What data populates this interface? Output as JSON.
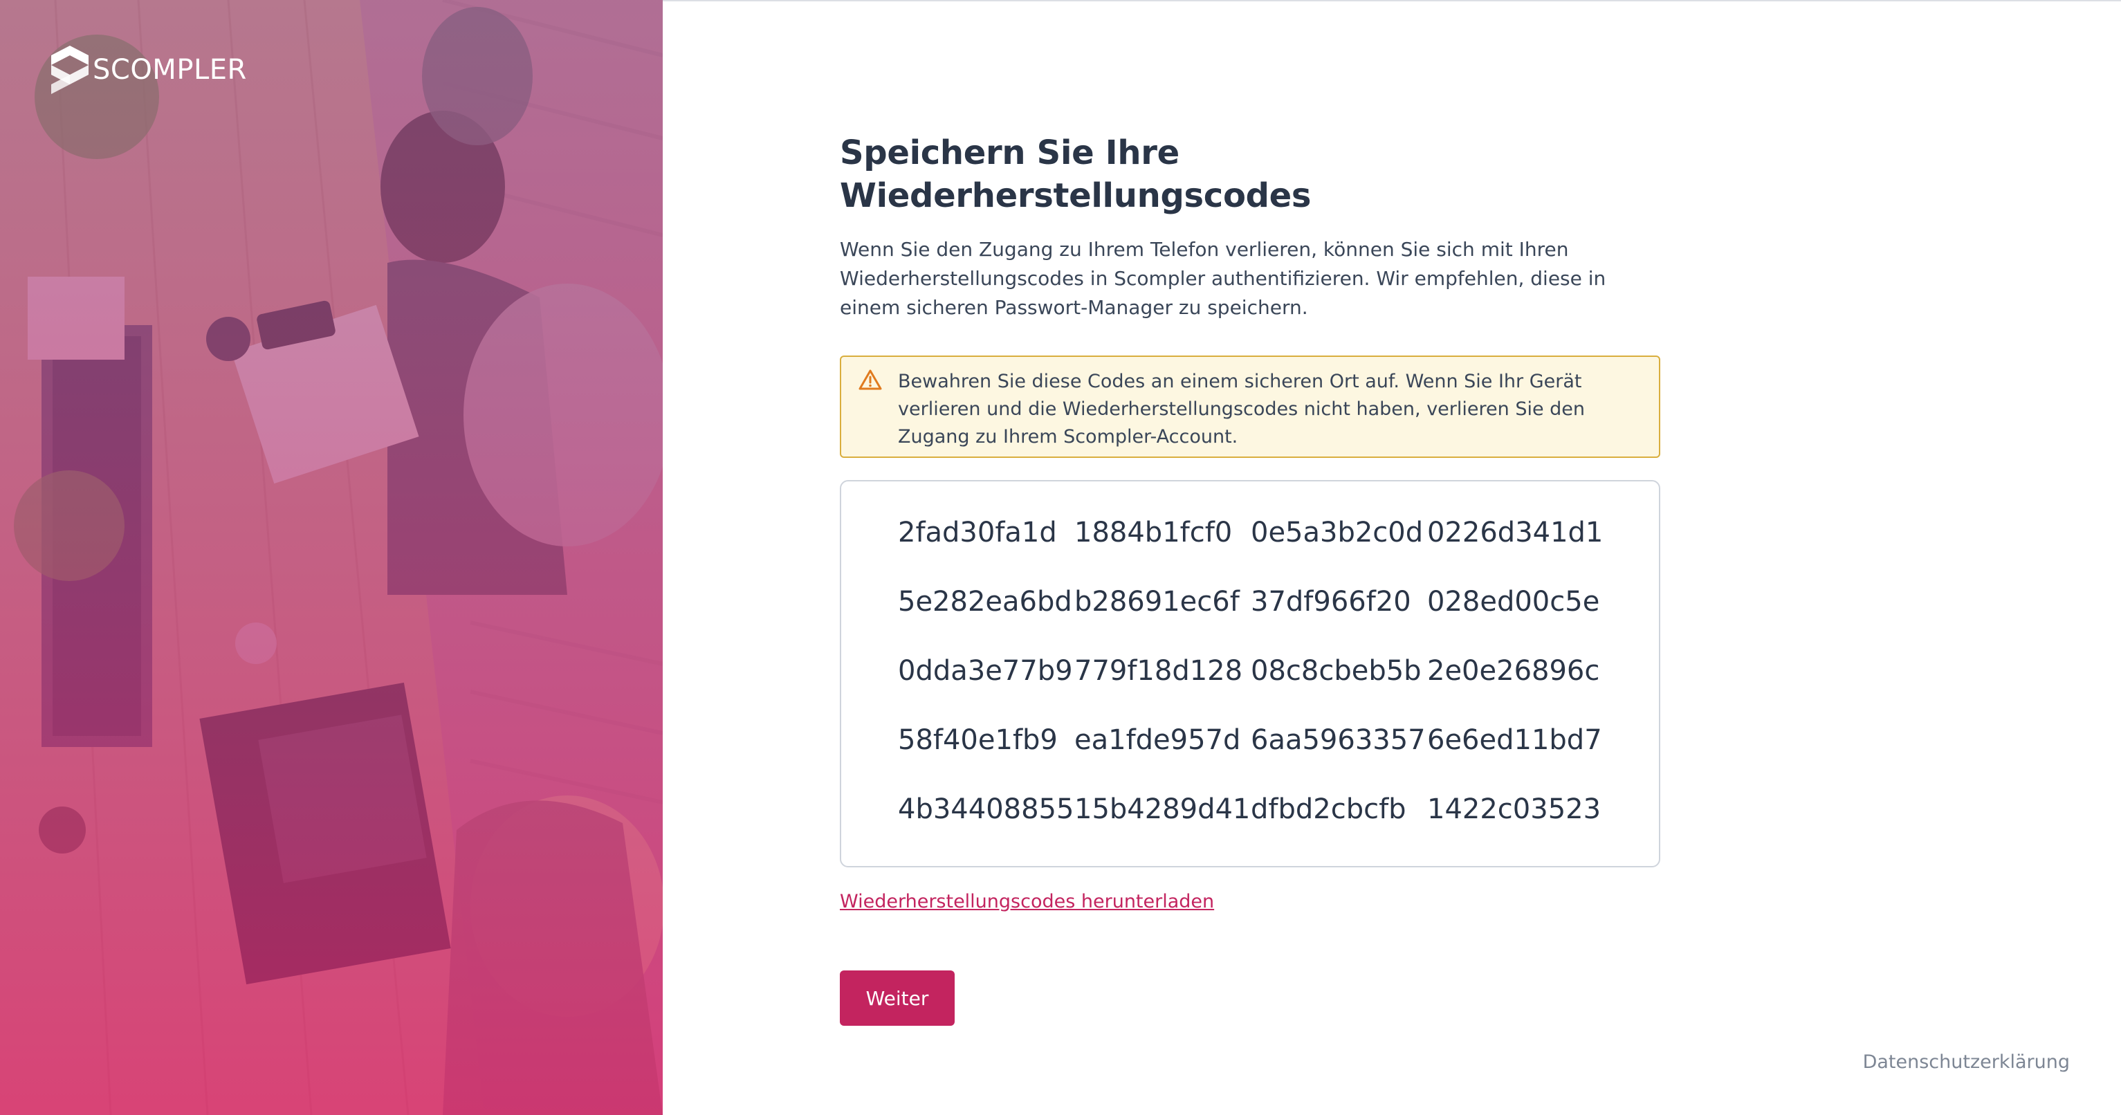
{
  "brand": {
    "name": "SCOMPLER"
  },
  "page": {
    "title": "Speichern Sie Ihre Wiederherstellungscodes",
    "intro": "Wenn Sie den Zugang zu Ihrem Telefon verlieren, können Sie sich mit Ihren Wiederherstellungscodes in Scompler authentifizieren. Wir empfehlen, diese in einem sicheren Passwort-Manager zu speichern."
  },
  "alert": {
    "icon": "warning-icon",
    "text": "Bewahren Sie diese Codes an einem sicheren Ort auf. Wenn Sie Ihr Gerät verlieren und die Wiederherstellungscodes nicht haben, verlieren Sie den Zugang zu Ihrem Scompler-Account."
  },
  "codes": [
    "2fad30fa1d",
    "1884b1fcf0",
    "0e5a3b2c0d",
    "0226d341d1",
    "5e282ea6bd",
    "b28691ec6f",
    "37df966f20",
    "028ed00c5e",
    "0dda3e77b9",
    "779f18d128",
    "08c8cbeb5b",
    "2e0e26896c",
    "58f40e1fb9",
    "ea1fde957d",
    "6aa5963357",
    "6e6ed11bd7",
    "4b34408855",
    "15b4289d41",
    "dfbd2cbcfb",
    "1422c03523"
  ],
  "actions": {
    "download_label": "Wiederherstellungscodes herunterladen",
    "next_label": "Weiter"
  },
  "footer": {
    "privacy_label": "Datenschutzerklärung"
  },
  "colors": {
    "accent": "#c3245f",
    "alert_bg": "#fdf7e1",
    "alert_border": "#d9ae3e",
    "heading": "#2a3547"
  }
}
